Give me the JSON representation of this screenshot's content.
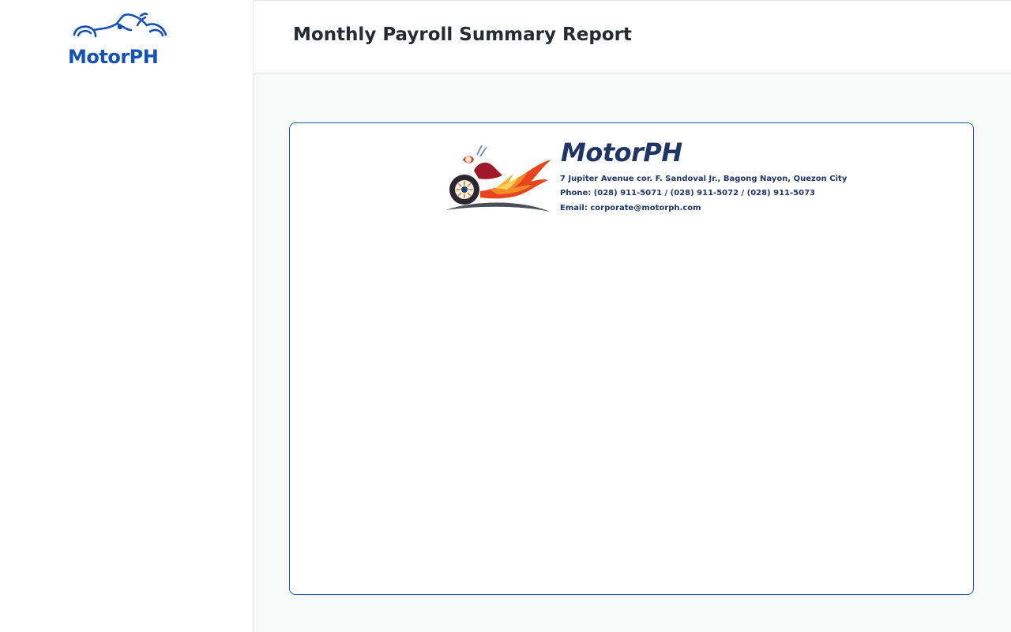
{
  "sidebar": {
    "logo_text": "MotorPH",
    "logo_icon": "motorcycle-icon"
  },
  "header": {
    "title": "Monthly Payroll Summary Report"
  },
  "report": {
    "letterhead": {
      "company_name": "MotorPH",
      "address": "7 Jupiter Avenue cor. F. Sandoval Jr., Bagong Nayon, Quezon City",
      "phone": "Phone: (028) 911-5071 / (028) 911-5072 / (028) 911-5073",
      "email": "Email: corporate@motorph.com",
      "logo_icon": "flaming-motorcycle-icon"
    }
  },
  "colors": {
    "brand_blue": "#1452b5",
    "letterhead_navy": "#1e3566",
    "card_border": "#1d56b8",
    "main_background": "#f8f9f9"
  }
}
